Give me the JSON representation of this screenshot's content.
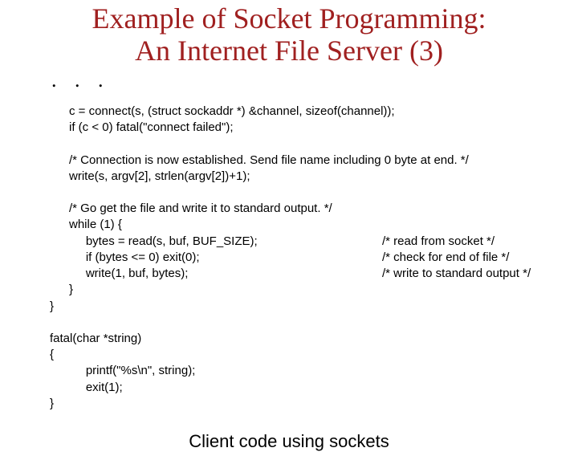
{
  "title_line1": "Example of Socket Programming:",
  "title_line2": "An Internet File Server (3)",
  "ellipsis": ".  .  .",
  "code": {
    "l01": "c = connect(s, (struct sockaddr *) &channel, sizeof(channel));",
    "l02": "if (c < 0) fatal(\"connect failed\");",
    "blank1": "",
    "l03": "/* Connection is now established. Send file name including 0 byte at end. */",
    "l04": "write(s, argv[2], strlen(argv[2])+1);",
    "blank2": "",
    "l05": "/* Go get the file and write it to standard output. */",
    "l06": "while (1) {",
    "l07_main": "     bytes = read(s, buf, BUF_SIZE);",
    "l07_cm": "/* read from socket */",
    "l08_main": "     if (bytes <= 0) exit(0);",
    "l08_cm": "/* check for end of file */",
    "l09_main": "     write(1, buf, bytes);",
    "l09_cm": "/* write to standard output */",
    "l10": "}",
    "l11": "}",
    "blank3": "",
    "l12": "fatal(char *string)",
    "l13": "{",
    "l14": "     printf(\"%s\\n\", string);",
    "l15": "     exit(1);",
    "l16": "}"
  },
  "caption": "Client code using sockets"
}
